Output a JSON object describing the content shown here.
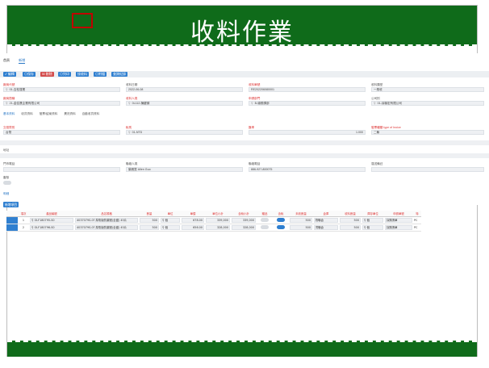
{
  "slide": {
    "title": "收料作業"
  },
  "nav": {
    "tab1": "首頁",
    "tab2": "新增"
  },
  "toolbar": {
    "new": "✓ 編輯",
    "save": "◎保存",
    "delete": "☒ 刪除",
    "print": "◎列印",
    "receive": "接收料",
    "attach": "◎附檔",
    "query": "查詢紀錄"
  },
  "form": {
    "vendor_label": "廠商代號",
    "vendor_value": "01-吉松運業",
    "date_label": "收料日期",
    "date_value": "2022-06-08",
    "order_no_label": "收料單號",
    "order_no_value": "RE202206080001",
    "type_label": "收料類型",
    "type_value": "一般收",
    "vendor_name_label": "廠商簡稱",
    "vendor_name_value": "21-金佳晟企業有限公司",
    "receiver_label": "收料人員",
    "receiver_value": "0L112-陳鍵頓",
    "dept_label": "申請部門",
    "dept_value": "B-總務課部",
    "company_label": "公司別",
    "company_value": "01-耳機宏有限公司"
  },
  "subtabs": [
    "基本資料",
    "收貨資料",
    "發票/結案資料",
    "異況資料",
    "自動收貨資料"
  ],
  "form2": {
    "currency_label": "交易幣別",
    "currency_value": "台幣",
    "tax_label": "稅別",
    "tax_value": "01-NTD",
    "rate_label": "匯率",
    "rate_value": "1.000",
    "invoice_label": "發票種類 type of Inoice",
    "invoice_value": "二聯",
    "memo_label": "地址",
    "contact_label": "門市電話",
    "person_label": "聯絡人員",
    "person_value": "葉雅雯 Allen Guo",
    "phone_label": "聯絡電話",
    "phone_value": "886-927-800075",
    "remark_label": "運送備註",
    "settle_label": "審核"
  },
  "detail": {
    "section_label": "明細",
    "add_button": "新增項目",
    "columns": [
      "項次",
      "產品編號",
      "品名規格",
      "數量",
      "單位",
      "單價",
      "單位小計",
      "含稅小計",
      "贈品",
      "含稅",
      "未收數量",
      "倉庫",
      "收料數量",
      "庫存單位",
      "申請單號",
      "特"
    ],
    "rows": [
      {
        "seq": "1",
        "code": "OLF180795-S0",
        "spec": "4037079S-0? 厚衛版防磨號(全盛) 45片",
        "qty": "500",
        "unit": "個",
        "price": "678.00",
        "subtotal": "339,000",
        "taxed": "339,000",
        "gift": false,
        "tax": true,
        "pending": "500",
        "warehouse": "物聯倉",
        "received": "500",
        "stock_unit": "個",
        "req_no": "採購清單",
        "extra": "PC"
      },
      {
        "seq": "2",
        "code": "OLF180796-S0",
        "spec": "4037079S-0? 厚衛版防磨號(全盛) 45片",
        "qty": "500",
        "unit": "個",
        "price": "656.00",
        "subtotal": "328,000",
        "taxed": "328,000",
        "gift": false,
        "tax": true,
        "pending": "500",
        "warehouse": "同聯倉",
        "received": "500",
        "stock_unit": "個",
        "req_no": "採購清單",
        "extra": "PC"
      }
    ]
  },
  "colors": {
    "band": "#0f6b1a",
    "accent": "#2f7fd0",
    "danger": "#d34b4b",
    "highlight": "#c00000"
  }
}
